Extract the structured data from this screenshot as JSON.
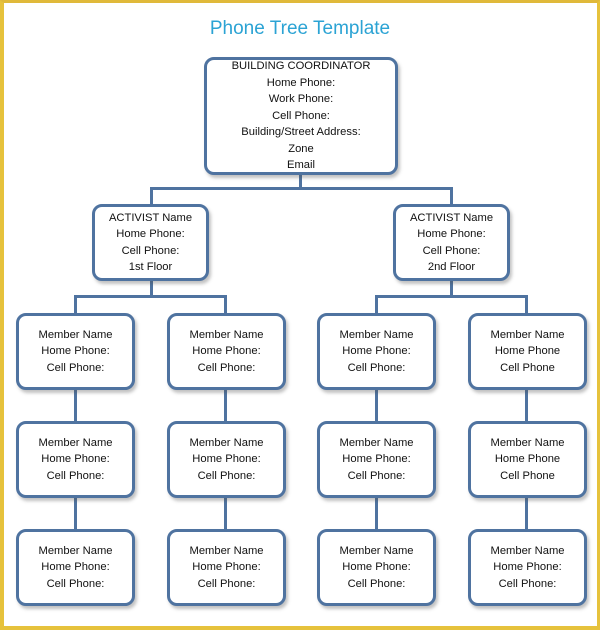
{
  "title": "Phone Tree Template",
  "colors": {
    "frame": "#e6c23c",
    "title": "#2ba3d4",
    "box_border": "#4f73a0",
    "connector": "#4f73a0"
  },
  "coordinator": {
    "lines": [
      "BUILDING COORDINATOR",
      "Home Phone:",
      "Work Phone:",
      "Cell Phone:",
      "Building/Street Address:",
      "Zone",
      "Email"
    ]
  },
  "activists": [
    {
      "lines": [
        "ACTIVIST  Name",
        "Home Phone:",
        "Cell Phone:",
        "1st Floor"
      ]
    },
    {
      "lines": [
        "ACTIVIST Name",
        "Home Phone:",
        "Cell Phone:",
        "2nd Floor"
      ]
    }
  ],
  "members": [
    [
      {
        "lines": [
          "Member Name",
          "Home Phone:",
          "Cell Phone:"
        ]
      },
      {
        "lines": [
          "Member Name",
          "Home Phone:",
          "Cell Phone:"
        ]
      },
      {
        "lines": [
          "Member Name",
          "Home Phone:",
          "Cell Phone:"
        ]
      }
    ],
    [
      {
        "lines": [
          "Member Name",
          "Home Phone:",
          "Cell Phone:"
        ]
      },
      {
        "lines": [
          "Member Name",
          "Home Phone:",
          "Cell Phone:"
        ]
      },
      {
        "lines": [
          "Member Name",
          "Home Phone:",
          "Cell Phone:"
        ]
      }
    ],
    [
      {
        "lines": [
          "Member Name",
          "Home Phone:",
          "Cell Phone:"
        ]
      },
      {
        "lines": [
          "Member Name",
          "Home Phone:",
          "Cell Phone:"
        ]
      },
      {
        "lines": [
          "Member Name",
          "Home Phone:",
          "Cell Phone:"
        ]
      }
    ],
    [
      {
        "lines": [
          "Member Name",
          "Home Phone",
          "Cell Phone"
        ]
      },
      {
        "lines": [
          "Member Name",
          "Home Phone",
          "Cell Phone"
        ]
      },
      {
        "lines": [
          "Member Name",
          "Home Phone:",
          "Cell Phone:"
        ]
      }
    ]
  ]
}
